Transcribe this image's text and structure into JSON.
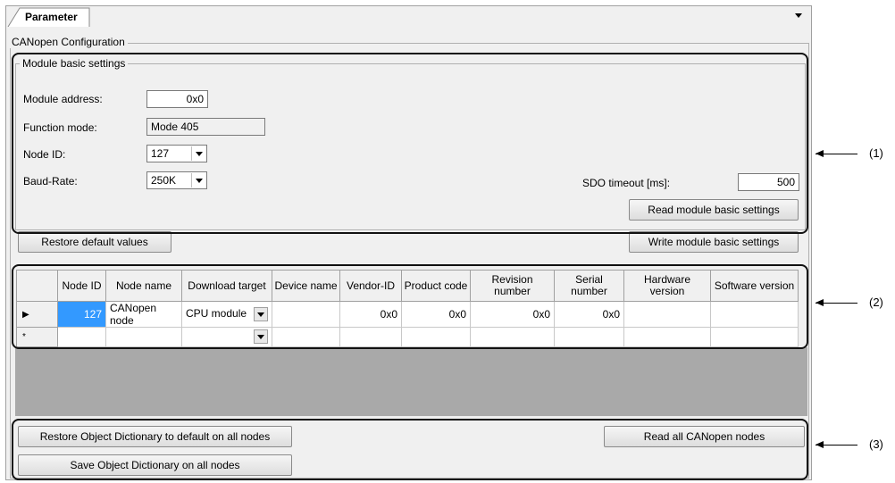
{
  "tab": {
    "label": "Parameter"
  },
  "config_group": {
    "title": "CANopen Configuration"
  },
  "basic": {
    "title": "Module basic settings",
    "module_address_label": "Module address:",
    "module_address_value": "0x0",
    "function_mode_label": "Function mode:",
    "function_mode_value": "Mode 405",
    "node_id_label": "Node ID:",
    "node_id_value": "127",
    "baud_rate_label": "Baud-Rate:",
    "baud_rate_value": "250K",
    "sdo_timeout_label": "SDO timeout [ms]:",
    "sdo_timeout_value": "500",
    "read_button": "Read module basic settings",
    "write_button": "Write module basic settings",
    "restore_button": "Restore default values"
  },
  "grid": {
    "headers": [
      "Node ID",
      "Node name",
      "Download target",
      "Device name",
      "Vendor-ID",
      "Product code",
      "Revision number",
      "Serial number",
      "Hardware version",
      "Software version"
    ],
    "row1": {
      "marker": "▶",
      "node_id": "127",
      "node_name": "CANopen node",
      "download_target": "CPU module",
      "device_name": "",
      "vendor_id": "0x0",
      "product_code": "0x0",
      "revision": "0x0",
      "serial": "0x0",
      "hardware": "",
      "software": ""
    },
    "row2": {
      "marker": "*"
    }
  },
  "bottom": {
    "restore_od_button": "Restore Object Dictionary to default on all nodes",
    "save_od_button": "Save Object Dictionary on all nodes",
    "read_all_button": "Read all CANopen nodes"
  },
  "callouts": [
    "(1)",
    "(2)",
    "(3)"
  ]
}
